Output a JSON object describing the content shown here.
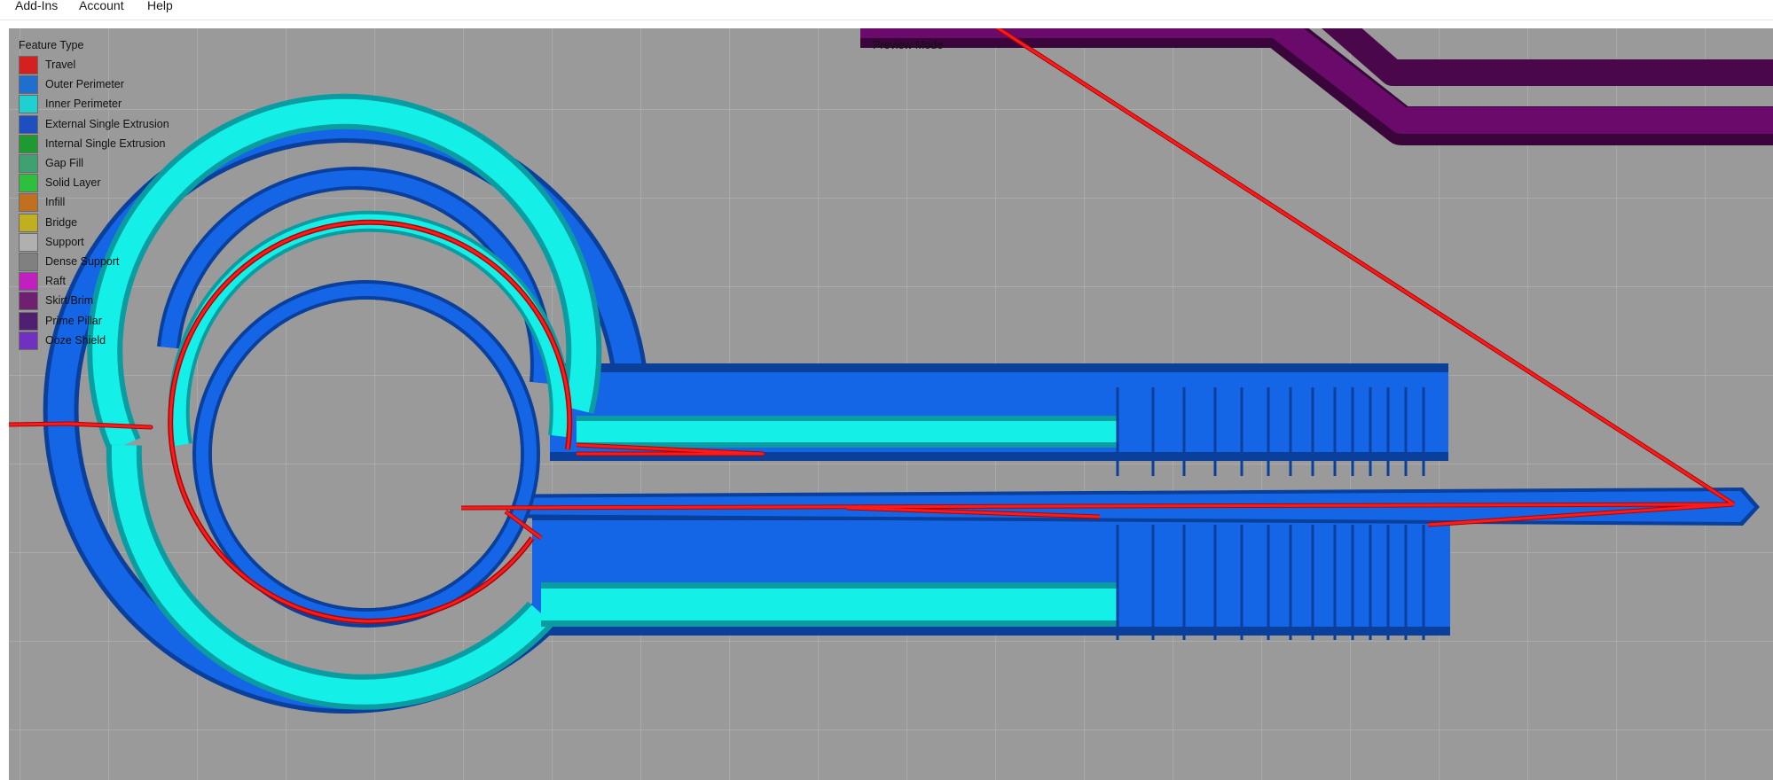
{
  "menu": {
    "items": [
      {
        "label": "Add-Ins"
      },
      {
        "label": "Account"
      },
      {
        "label": "Help"
      }
    ]
  },
  "viewport": {
    "preview_mode_label": "Preview Mode",
    "background_color": "#9a9a9a",
    "grid_color": "#b0b0b0"
  },
  "legend": {
    "title": "Feature Type",
    "items": [
      {
        "label": "Travel",
        "color": "#d42020"
      },
      {
        "label": "Outer Perimeter",
        "color": "#1e6fd0"
      },
      {
        "label": "Inner Perimeter",
        "color": "#1fd0d0"
      },
      {
        "label": "External Single Extrusion",
        "color": "#1e4fc0"
      },
      {
        "label": "Internal Single Extrusion",
        "color": "#1e9a30"
      },
      {
        "label": "Gap Fill",
        "color": "#3fa070"
      },
      {
        "label": "Solid Layer",
        "color": "#2fbf3f"
      },
      {
        "label": "Infill",
        "color": "#c07020"
      },
      {
        "label": "Bridge",
        "color": "#c0b020"
      },
      {
        "label": "Support",
        "color": "#b0b0b0"
      },
      {
        "label": "Dense Support",
        "color": "#808080"
      },
      {
        "label": "Raft",
        "color": "#c020c0"
      },
      {
        "label": "Skirt/Brim",
        "color": "#702070"
      },
      {
        "label": "Prime Pillar",
        "color": "#502070"
      },
      {
        "label": "Ooze Shield",
        "color": "#7030c0"
      }
    ]
  },
  "model_colors": {
    "outer_perimeter": "#1466e6",
    "outer_shadow": "#0a3f9c",
    "inner_perimeter": "#14f0e8",
    "inner_shadow": "#0a9ca0",
    "travel": "#e01010",
    "skirt": "#6a0a6a"
  }
}
